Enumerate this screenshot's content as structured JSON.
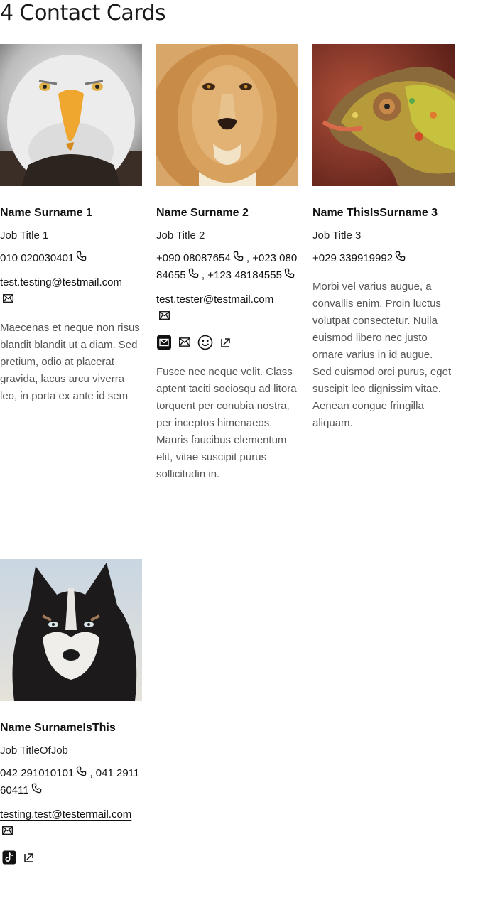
{
  "page": {
    "title": "4 Contact Cards"
  },
  "cards": [
    {
      "name": "Name Surname 1",
      "job": "Job Title 1",
      "phones": [
        "010 020030401"
      ],
      "email": "test.testing@testmail.com",
      "description": "Maecenas et neque non risus blandit blandit ut a diam. Sed pretium, odio at placerat gravida, lacus arcu viverra leo, in porta ex ante id sem",
      "photo": "eagle"
    },
    {
      "name": "Name Surname 2",
      "job": "Job Title 2",
      "phones": [
        "+090 08087654",
        "+023 08084655",
        "+123 48184555"
      ],
      "email": "test.tester@testmail.com",
      "social_icons": [
        "email-box-icon",
        "mail-icon",
        "smiley-icon",
        "external-link-icon"
      ],
      "description": "Fusce nec neque velit. Class aptent taciti sociosqu ad litora torquent per conubia nostra, per inceptos himenaeos. Mauris faucibus elementum elit, vitae suscipit purus sollicitudin in.",
      "photo": "lion"
    },
    {
      "name": "Name ThisIsSurname 3",
      "job": "Job Title 3",
      "phones": [
        "+029 339919992"
      ],
      "description": "Morbi vel varius augue, a convallis enim. Proin luctus volutpat consectetur. Nulla euismod libero nec justo ornare varius in id augue. Sed euismod orci purus, eget suscipit leo dignissim vitae. Aenean congue fringilla aliquam.",
      "photo": "chameleon"
    },
    {
      "name": "Name SurnameIsThis",
      "job": "Job TitleOfJob",
      "phones": [
        "042 291010101",
        "041 291160411"
      ],
      "email": "testing.test@testermail.com",
      "social_icons": [
        "tiktok-icon",
        "external-link-icon"
      ],
      "photo": "husky"
    }
  ],
  "separator": ",",
  "colors": {
    "text": "#111111",
    "muted": "#555555"
  }
}
